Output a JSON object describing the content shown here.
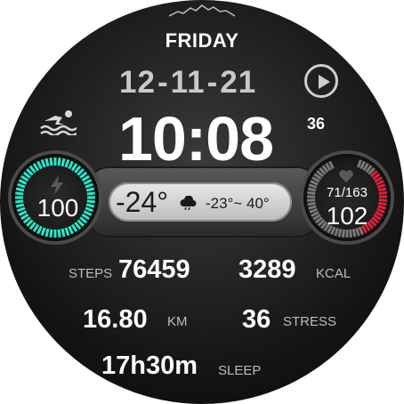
{
  "watch": {
    "day": "FRIDAY",
    "date": {
      "day": "12",
      "month": "11",
      "year": "21",
      "separator": "-"
    },
    "time": "10:08",
    "seconds": "36"
  },
  "battery": {
    "value": "100",
    "level_fraction": 1.0,
    "color": "#2ee6c4"
  },
  "weather": {
    "current": "-24°",
    "range": "-23°~ 40°"
  },
  "heart_rate": {
    "range": "71/163",
    "value": "102",
    "colors": {
      "normal": "#7a7a7a",
      "high": "#e0213a"
    }
  },
  "stats": {
    "steps": {
      "label": "STEPS",
      "value": "76459"
    },
    "kcal": {
      "label": "KCAL",
      "value": "3289"
    },
    "km": {
      "label": "KM",
      "value": "16.80"
    },
    "stress": {
      "label": "STRESS",
      "value": "36"
    },
    "sleep": {
      "label": "SLEEP",
      "value": "17h30m"
    }
  },
  "icons": [
    "mountain-icon",
    "play-icon",
    "swim-icon",
    "bolt-icon",
    "cloud-icon",
    "heart-icon"
  ]
}
